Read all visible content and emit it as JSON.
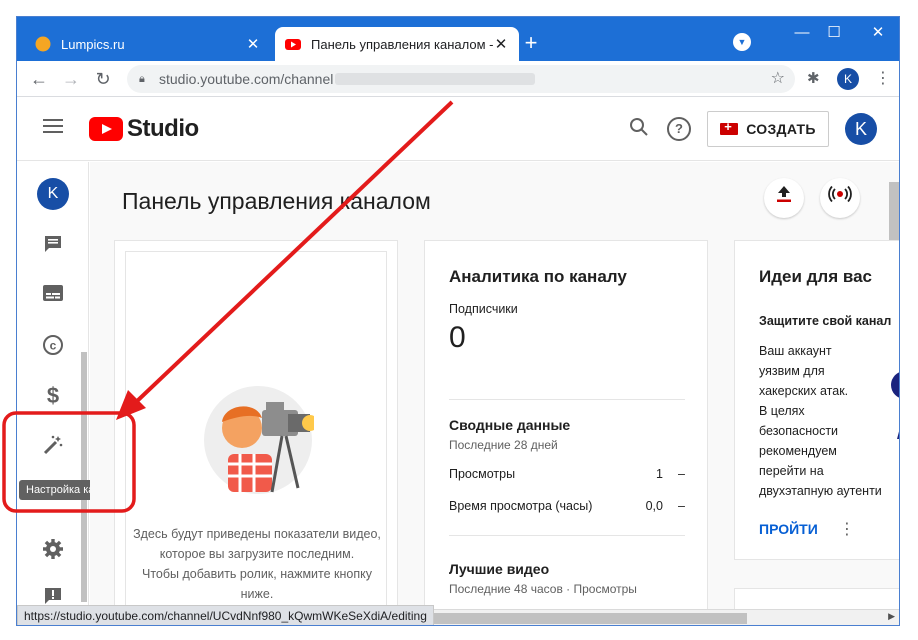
{
  "browser": {
    "tabs": [
      {
        "title": "Lumpics.ru",
        "favicon": "lumpics-favicon",
        "active": false
      },
      {
        "title": "Панель управления каналом - Y",
        "favicon": "youtube-favicon",
        "active": true
      }
    ],
    "new_tab_symbol": "+",
    "window_controls": {
      "minimize": "—",
      "maximize": "☐",
      "close": "✕"
    },
    "address": {
      "url": "studio.youtube.com/channel"
    },
    "profile_initial": "K"
  },
  "header": {
    "logo_text": "Studio",
    "create_label": "СОЗДАТЬ",
    "avatar_initial": "K",
    "icons": [
      "search-icon",
      "help-icon"
    ]
  },
  "sidebar": {
    "avatar_initial": "K",
    "items": [
      {
        "name": "comments",
        "icon": "comment-icon"
      },
      {
        "name": "subtitles",
        "icon": "subtitles-icon"
      },
      {
        "name": "copyright",
        "icon": "copyright-icon"
      },
      {
        "name": "monetization",
        "icon": "dollar-icon"
      },
      {
        "name": "customization",
        "icon": "magic-wand-icon"
      },
      {
        "name": "settings",
        "icon": "gear-icon"
      },
      {
        "name": "feedback",
        "icon": "feedback-icon"
      }
    ],
    "tooltip": "Настройка канала"
  },
  "main": {
    "title": "Панель управления каналом",
    "upload_card": {
      "text_lines": [
        "Здесь будут приведены показатели видео,",
        "которое вы загрузите последним.",
        "Чтобы добавить ролик, нажмите кнопку",
        "ниже."
      ]
    },
    "analytics": {
      "title": "Аналитика по каналу",
      "subscribers_label": "Подписчики",
      "subscribers_value": "0",
      "summary_title": "Сводные данные",
      "summary_period": "Последние 28 дней",
      "rows": [
        {
          "label": "Просмотры",
          "value": "1",
          "trend": "–"
        },
        {
          "label": "Время просмотра (часы)",
          "value": "0,0",
          "trend": "–"
        }
      ],
      "top_title": "Лучшие видео",
      "top_period": "Последние 48 часов · Просмотры"
    },
    "ideas": {
      "title": "Идеи для вас",
      "subtitle": "Защитите свой канал",
      "body_lines": [
        "Ваш аккаунт",
        "уязвим для",
        "хакерских атак.",
        "В целях",
        "безопасности",
        "рекомендуем",
        "перейти на",
        "двухэтапную аутенти"
      ],
      "action": "ПРОЙТИ"
    }
  },
  "status_bar": {
    "url": "https://studio.youtube.com/channel/UCvdNnf980_kQwmWKeSeXdiA/editing"
  },
  "colors": {
    "tab_strip": "#1d6fd6",
    "youtube_red": "#ff0000",
    "link_blue": "#065fd4",
    "avatar": "#174ea6",
    "annotation": "#e31b1b"
  }
}
